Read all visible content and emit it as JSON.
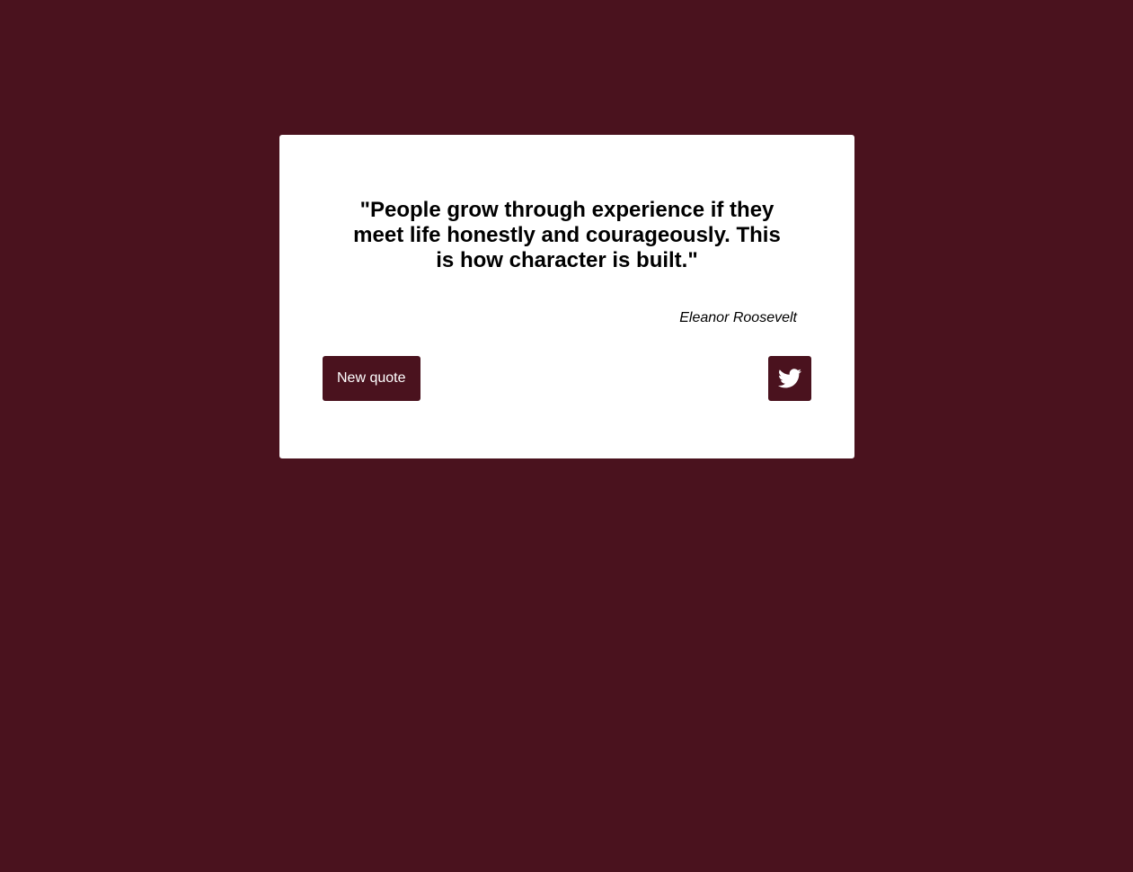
{
  "quote": {
    "text": "\"People grow through experience if they meet life honestly and courageously. This is how character is built.\"",
    "author": "Eleanor Roosevelt"
  },
  "buttons": {
    "new_quote_label": "New quote",
    "tweet_icon": "twitter-bird-icon"
  },
  "colors": {
    "background": "#4a121e",
    "card": "#ffffff",
    "button": "#4a121e",
    "button_text": "#ffffff",
    "text": "#000000"
  }
}
